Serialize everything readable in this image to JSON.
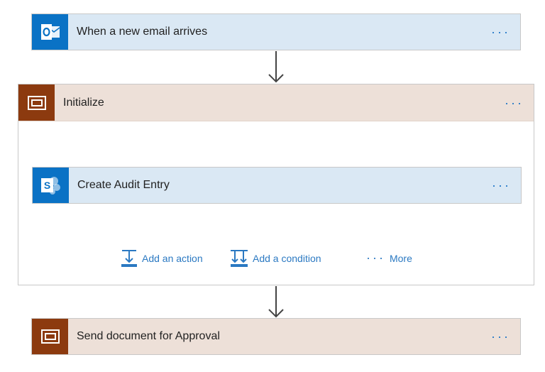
{
  "trigger": {
    "title": "When a new email arrives",
    "icon": "outlook-icon",
    "menu": "···"
  },
  "scope": {
    "title": "Initialize",
    "icon": "scope-icon",
    "menu": "···",
    "inner_action": {
      "title": "Create Audit Entry",
      "icon": "sharepoint-icon",
      "menu": "···"
    },
    "add_action_label": "Add an action",
    "add_condition_label": "Add a condition",
    "more_label": "More",
    "more_dots": "···"
  },
  "final_action": {
    "title": "Send document for Approval",
    "icon": "scope-icon",
    "menu": "···"
  },
  "colors": {
    "blue_card": "#dae8f4",
    "blue_icon": "#0a72c5",
    "brown_card": "#ede0d8",
    "brown_icon": "#8c3a0f",
    "link": "#2b79c2"
  }
}
